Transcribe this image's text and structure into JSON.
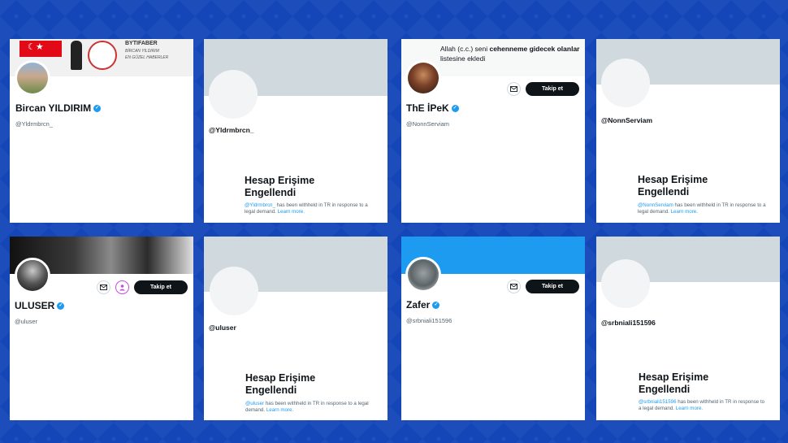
{
  "cards": {
    "c1": {
      "name": "Bircan YILDIRIM",
      "handle": "@Yldrmbrcn_",
      "banner_text": "BYTIFABER",
      "banner_sub": "BİRCAN YILDIRIM",
      "banner_slogan": "EN GÜZEL HABERLER"
    },
    "c2": {
      "handle": "@Yldrmbrcn_",
      "title": "Hesap Erişime Engellendi",
      "text_handle": "@Yldrmbrcn_",
      "text_rest": " has been withheld in TR in response to a legal demand. ",
      "link": "Learn more."
    },
    "c3": {
      "quote_1": "Allah (c.c.) seni ",
      "quote_bold": "cehenneme gidecek olanlar",
      "quote_2": " listesine ekledi",
      "name": "ThE İPeK",
      "handle": "@NonnServiam",
      "follow": "Takip et"
    },
    "c4": {
      "handle": "@NonnServiam",
      "title": "Hesap Erişime Engellendi",
      "text_handle": "@NonnServiam",
      "text_rest": " has been withheld in TR in response to a legal demand. ",
      "link": "Learn more."
    },
    "c5": {
      "name": "ULUSER",
      "handle": "@uluser",
      "follow": "Takip et"
    },
    "c6": {
      "handle": "@uluser",
      "title": "Hesap Erişime Engellendi",
      "text_handle": "@uluser",
      "text_rest": " has been withheld in TR in response to a legal demand. ",
      "link": "Learn more."
    },
    "c7": {
      "name": "Zafer",
      "handle": "@srbniali151596",
      "follow": "Takip et"
    },
    "c8": {
      "handle": "@srbniali151596",
      "title": "Hesap Erişime Engellendi",
      "text_handle": "@srbniali151596",
      "text_rest": " has been withheld in TR in response to a legal demand. ",
      "link": "Learn more."
    }
  },
  "colors": {
    "background": "#1446b8",
    "verified": "#1d9bf0",
    "button": "#0f1419"
  },
  "icons": [
    "verified-badge-icon",
    "mail-icon",
    "person-icon"
  ]
}
